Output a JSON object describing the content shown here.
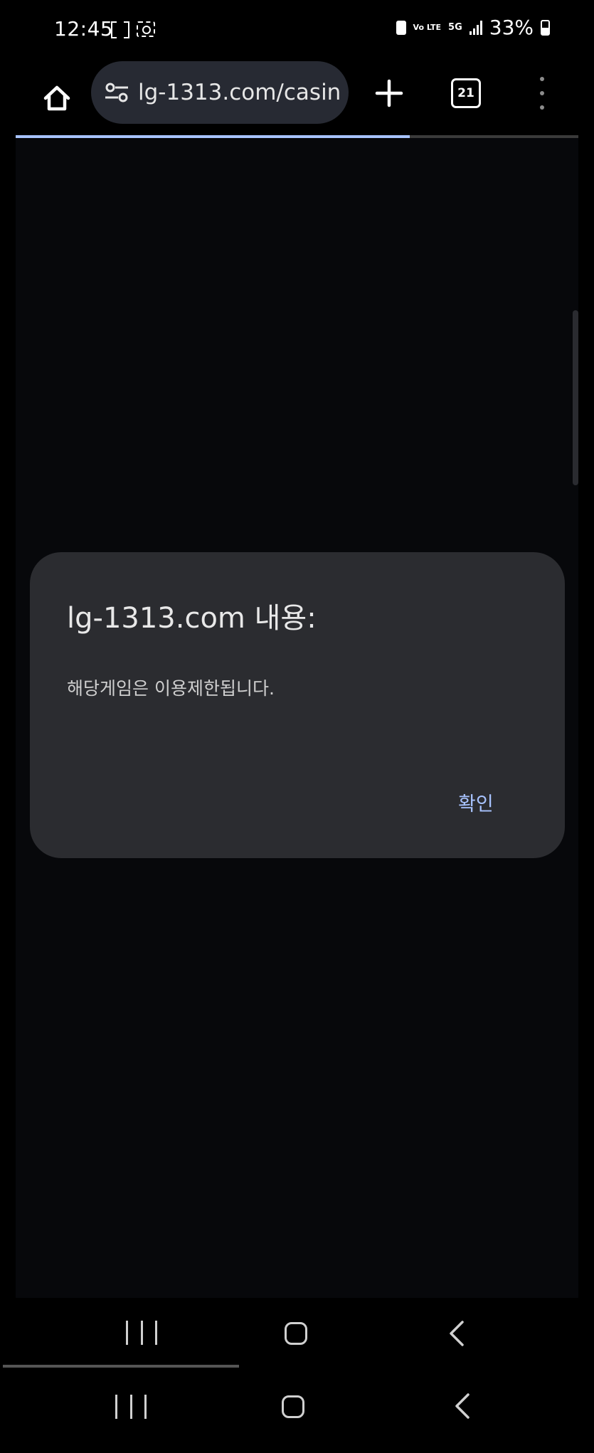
{
  "status_bar": {
    "time": "12:45",
    "battery_percent": "33%",
    "network_5g": "5G",
    "volte": "Vo LTE"
  },
  "browser": {
    "url": "lg-1313.com/casin",
    "tab_count": "21",
    "load_progress": 0.7
  },
  "dialog": {
    "title": "lg-1313.com 내용:",
    "message": "해당게임은 이용제한됩니다.",
    "ok_label": "확인"
  },
  "icons": {
    "home": "home-icon",
    "site_settings": "tune-icon",
    "new_tab": "plus-icon",
    "tabs": "tab-switcher-icon",
    "menu": "more-vert-icon",
    "nav_recents": "recents-icon",
    "nav_home": "nav-home-icon",
    "nav_back": "back-icon"
  },
  "colors": {
    "accent": "#a8c3ff",
    "dialog_bg": "#2b2c30",
    "url_pill_bg": "#272a33",
    "page_bg": "#07080b"
  }
}
